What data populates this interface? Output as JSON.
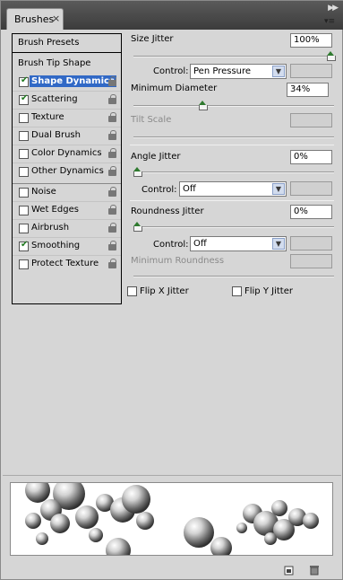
{
  "panel": {
    "tab_title": "Brushes",
    "tab_close": "×",
    "collapse_glyph": "▶▶",
    "menu_glyph": "▾≡"
  },
  "left": {
    "presets_label": "Brush Presets",
    "tip_shape_label": "Brush Tip Shape",
    "options": [
      {
        "label": "Shape Dynamics",
        "checked": true,
        "selected": true
      },
      {
        "label": "Scattering",
        "checked": true,
        "selected": false
      },
      {
        "label": "Texture",
        "checked": false,
        "selected": false
      },
      {
        "label": "Dual Brush",
        "checked": false,
        "selected": false
      },
      {
        "label": "Color Dynamics",
        "checked": false,
        "selected": false
      },
      {
        "label": "Other Dynamics",
        "checked": false,
        "selected": false
      },
      {
        "label": "Noise",
        "checked": false,
        "selected": false
      },
      {
        "label": "Wet Edges",
        "checked": false,
        "selected": false
      },
      {
        "label": "Airbrush",
        "checked": false,
        "selected": false
      },
      {
        "label": "Smoothing",
        "checked": true,
        "selected": false
      },
      {
        "label": "Protect Texture",
        "checked": false,
        "selected": false
      }
    ]
  },
  "right": {
    "size_jitter_label": "Size Jitter",
    "size_jitter_value": "100%",
    "size_control_label": "Control:",
    "size_control_value": "Pen Pressure",
    "min_diameter_label": "Minimum Diameter",
    "min_diameter_value": "34%",
    "tilt_scale_label": "Tilt Scale",
    "angle_jitter_label": "Angle Jitter",
    "angle_jitter_value": "0%",
    "angle_control_label": "Control:",
    "angle_control_value": "Off",
    "roundness_jitter_label": "Roundness Jitter",
    "roundness_jitter_value": "0%",
    "roundness_control_label": "Control:",
    "roundness_control_value": "Off",
    "min_roundness_label": "Minimum Roundness",
    "flip_x_label": "Flip X Jitter",
    "flip_y_label": "Flip Y Jitter"
  },
  "sliders": {
    "size_jitter": 1.0,
    "min_diameter": 0.34,
    "angle_jitter": 0.0,
    "roundness_jitter": 0.0
  },
  "colors": {
    "selection": "#3169c6",
    "thumb": "#2f7a2f"
  }
}
